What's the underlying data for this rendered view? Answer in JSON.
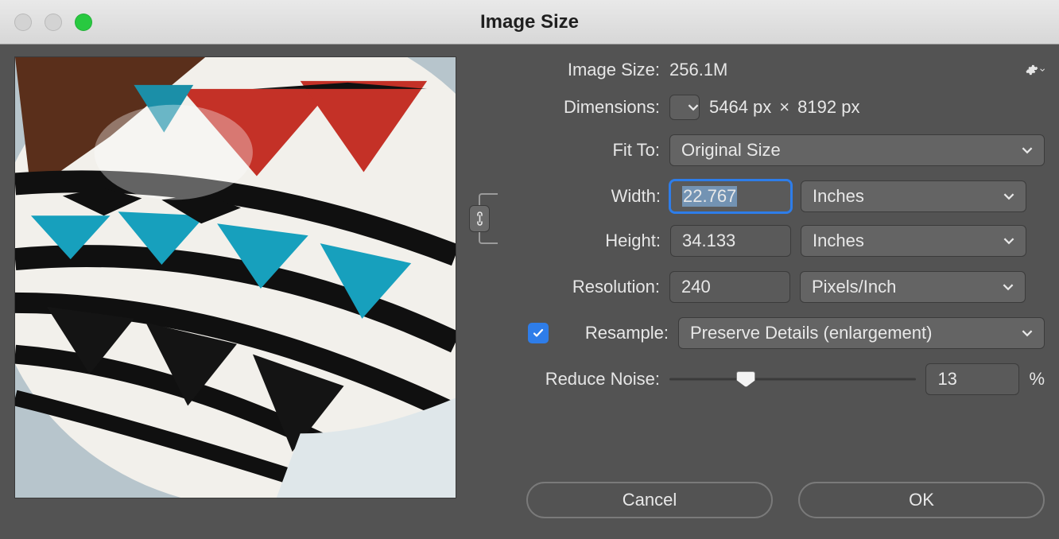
{
  "window": {
    "title": "Image Size"
  },
  "labels": {
    "image_size": "Image Size:",
    "dimensions": "Dimensions:",
    "fit_to": "Fit To:",
    "width": "Width:",
    "height": "Height:",
    "resolution": "Resolution:",
    "resample": "Resample:",
    "reduce_noise": "Reduce Noise:"
  },
  "image_size_value": "256.1M",
  "dimensions_value": {
    "w": "5464 px",
    "x": "×",
    "h": "8192 px"
  },
  "fit_to": "Original Size",
  "width": "22.767",
  "width_unit": "Inches",
  "height": "34.133",
  "height_unit": "Inches",
  "resolution": "240",
  "resolution_unit": "Pixels/Inch",
  "resample_checked": true,
  "resample_method": "Preserve Details (enlargement)",
  "reduce_noise": "13",
  "reduce_noise_pos_percent": 31,
  "percent_sign": "%",
  "buttons": {
    "cancel": "Cancel",
    "ok": "OK"
  }
}
